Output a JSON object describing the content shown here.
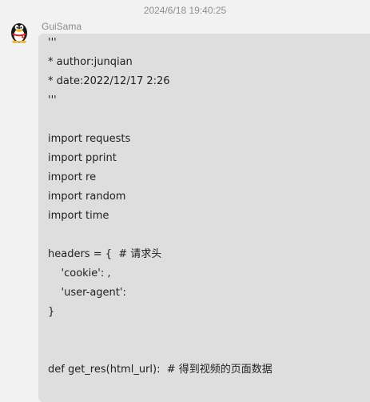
{
  "message": {
    "timestamp": "2024/6/18 19:40:25",
    "sender": "GuiSama",
    "avatar_icon": "qq-penguin-icon",
    "lines": [
      "'''",
      "* author:junqian",
      "* date:2022/12/17 2:26",
      "'''",
      "",
      "import requests",
      "import pprint",
      "import re",
      "import random",
      "import time",
      "",
      "headers = {  # 请求头",
      "    'cookie': ,",
      "    'user-agent':",
      "}",
      "",
      "",
      "def get_res(html_url):  # 得到视频的页面数据"
    ]
  },
  "colors": {
    "page_bg": "#f2f2f2",
    "bubble_bg": "#dedede",
    "text": "#1f1f1f",
    "meta_text": "#8f8f8f"
  }
}
